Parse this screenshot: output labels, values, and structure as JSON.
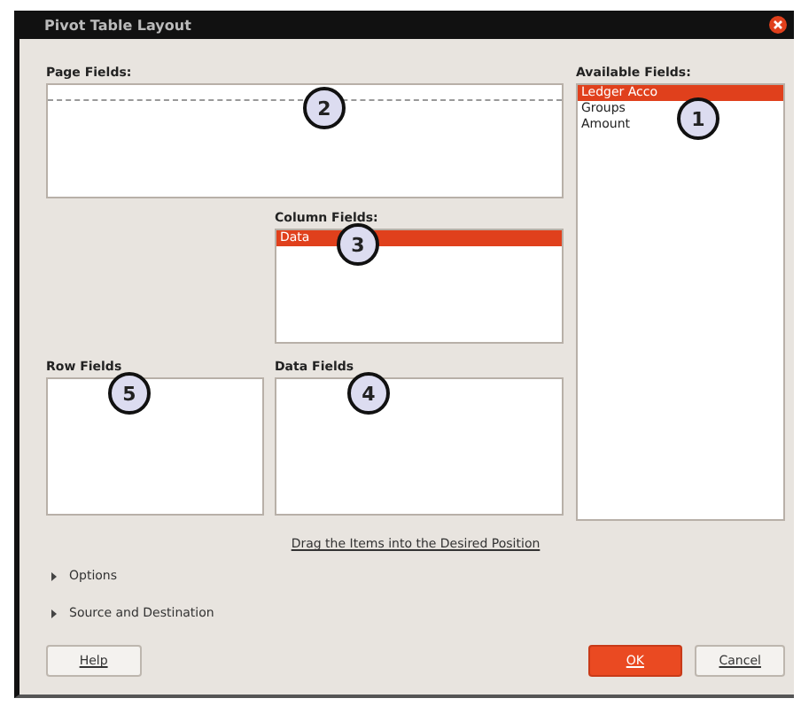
{
  "window": {
    "title": "Pivot Table Layout"
  },
  "page_fields": {
    "label": "Page Fields:",
    "annotation": "2"
  },
  "available_fields": {
    "label": "Available Fields:",
    "annotation": "1",
    "items": [
      {
        "label": "Ledger Acco",
        "selected": true
      },
      {
        "label": "Groups",
        "selected": false
      },
      {
        "label": "Amount",
        "selected": false
      }
    ]
  },
  "column_fields": {
    "label": "Column Fields:",
    "annotation": "3",
    "items": [
      {
        "label": "Data",
        "selected": true
      }
    ]
  },
  "row_fields": {
    "label": "Row Fields",
    "annotation": "5"
  },
  "data_fields": {
    "label": "Data Fields",
    "annotation": "4"
  },
  "hint": "Drag the Items into the Desired Position",
  "expanders": [
    {
      "label": "Options",
      "expanded": false
    },
    {
      "label": "Source and Destination",
      "expanded": false
    }
  ],
  "buttons": [
    {
      "label": "Help",
      "kind": "plain"
    },
    {
      "label": "OK",
      "kind": "primary"
    },
    {
      "label": "Cancel",
      "kind": "plain"
    }
  ]
}
